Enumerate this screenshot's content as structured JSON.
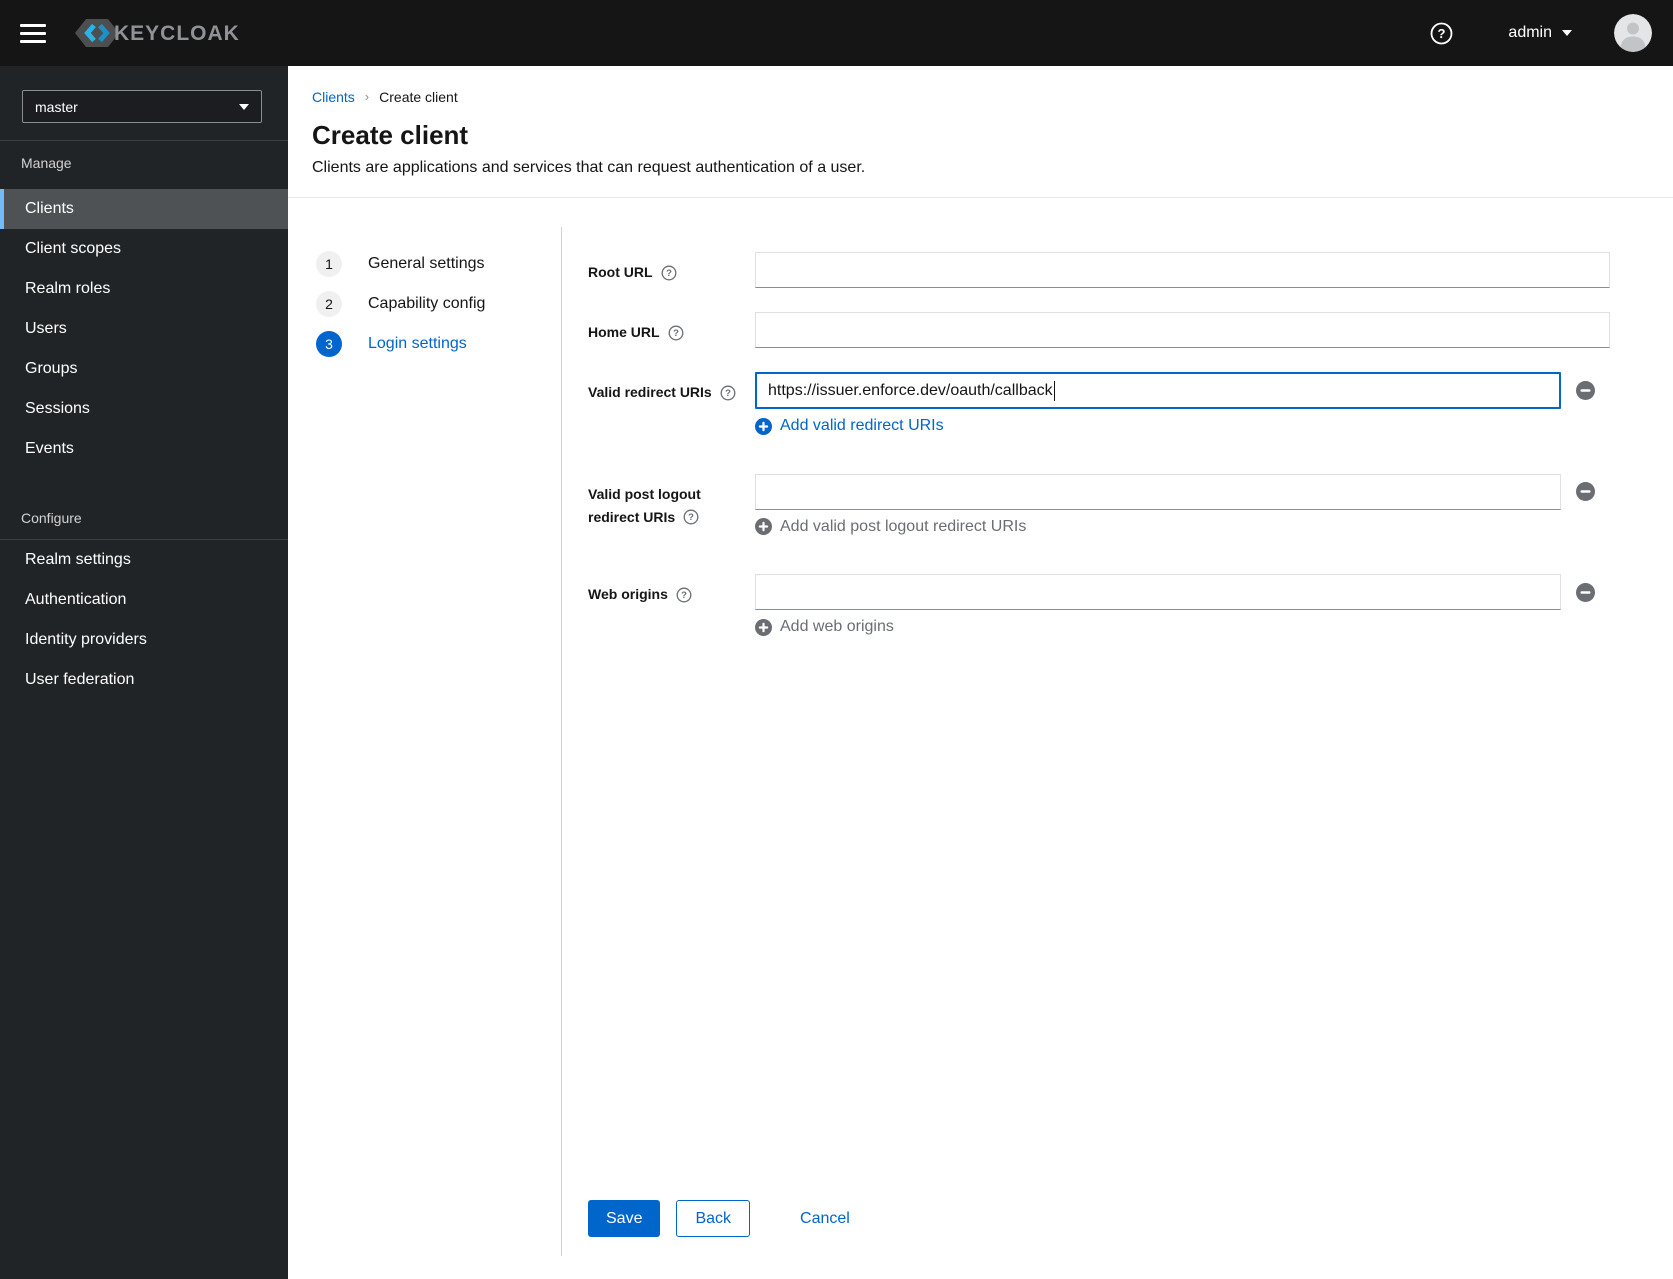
{
  "header": {
    "brand": "KEYCLOAK",
    "user_menu": {
      "label": "admin"
    }
  },
  "sidebar": {
    "realm_selector": {
      "value": "master"
    },
    "manage": {
      "title": "Manage",
      "items": [
        {
          "label": "Clients"
        },
        {
          "label": "Client scopes"
        },
        {
          "label": "Realm roles"
        },
        {
          "label": "Users"
        },
        {
          "label": "Groups"
        },
        {
          "label": "Sessions"
        },
        {
          "label": "Events"
        }
      ]
    },
    "configure": {
      "title": "Configure",
      "items": [
        {
          "label": "Realm settings"
        },
        {
          "label": "Authentication"
        },
        {
          "label": "Identity providers"
        },
        {
          "label": "User federation"
        }
      ]
    }
  },
  "breadcrumb": {
    "link": "Clients",
    "current": "Create client"
  },
  "page": {
    "title": "Create client",
    "subtitle": "Clients are applications and services that can request authentication of a user."
  },
  "wizard": {
    "steps": [
      {
        "number": "1",
        "label": "General settings"
      },
      {
        "number": "2",
        "label": "Capability config"
      },
      {
        "number": "3",
        "label": "Login settings"
      }
    ]
  },
  "form": {
    "root_url": {
      "label": "Root URL",
      "value": ""
    },
    "home_url": {
      "label": "Home URL",
      "value": ""
    },
    "valid_redirect_uris": {
      "label": "Valid redirect URIs",
      "value": "https://issuer.enforce.dev/oauth/callback",
      "add_label": "Add valid redirect URIs"
    },
    "valid_post_logout_redirect_uris": {
      "label_line1": "Valid post logout",
      "label_line2": "redirect URIs",
      "value": "",
      "add_label": "Add valid post logout redirect URIs"
    },
    "web_origins": {
      "label": "Web origins",
      "value": "",
      "add_label": "Add web origins"
    }
  },
  "actions": {
    "save": "Save",
    "back": "Back",
    "cancel": "Cancel"
  },
  "colors": {
    "accent": "#0066cc",
    "masthead": "#151515",
    "sidebar": "#212427",
    "selected_item_bg": "#4f5255",
    "selected_item_border": "#73bcf7",
    "muted_text": "#6a6e73",
    "step_circle_bg": "#f0f0f0"
  }
}
